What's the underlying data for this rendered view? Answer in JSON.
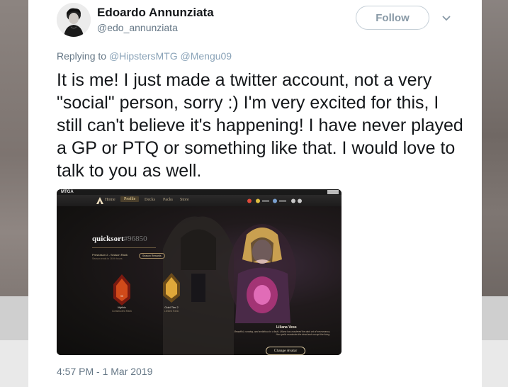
{
  "user": {
    "display_name": "Edoardo Annunziata",
    "handle": "@edo_annunziata"
  },
  "follow_label": "Follow",
  "replying": {
    "prefix": "Replying to",
    "mention1": "@HipstersMTG",
    "mention2": "@Mengu09"
  },
  "tweet_text": "It is me! I just made a twitter account, not a very \"social\" person, sorry :) I'm very excited for this, I still can't believe it's happening! I have never played a GP or PTQ or something like that. I would love to talk to you as well.",
  "timestamp": "4:57 PM - 1 Mar 2019",
  "media": {
    "app_title": "MTGA",
    "tabs": [
      "Home",
      "Profile",
      "Decks",
      "Packs",
      "Store"
    ],
    "username": "quicksort",
    "tag": "#96850",
    "season_title": "Preseason 2 - Season Rank",
    "season_sub": "Season ends in 16 th hours",
    "season_rewards": "Season Rewards",
    "ranks": [
      {
        "label": "Mythic",
        "sub": "Constructed Rank",
        "number": "95"
      },
      {
        "label": "Gold Tier 2",
        "sub": "Limited Rank"
      }
    ],
    "character_name": "Liliana Vess",
    "character_flavor": "Beautiful, cunning, and ambitious to a fault, Liliana has mastered the dark art of necromancy. Her spells reanimate the dead and corrupt the living.",
    "change_avatar": "Change Avatar"
  },
  "colors": {
    "mention": "#8aa3b8",
    "muted": "#657786",
    "text": "#14171a"
  }
}
